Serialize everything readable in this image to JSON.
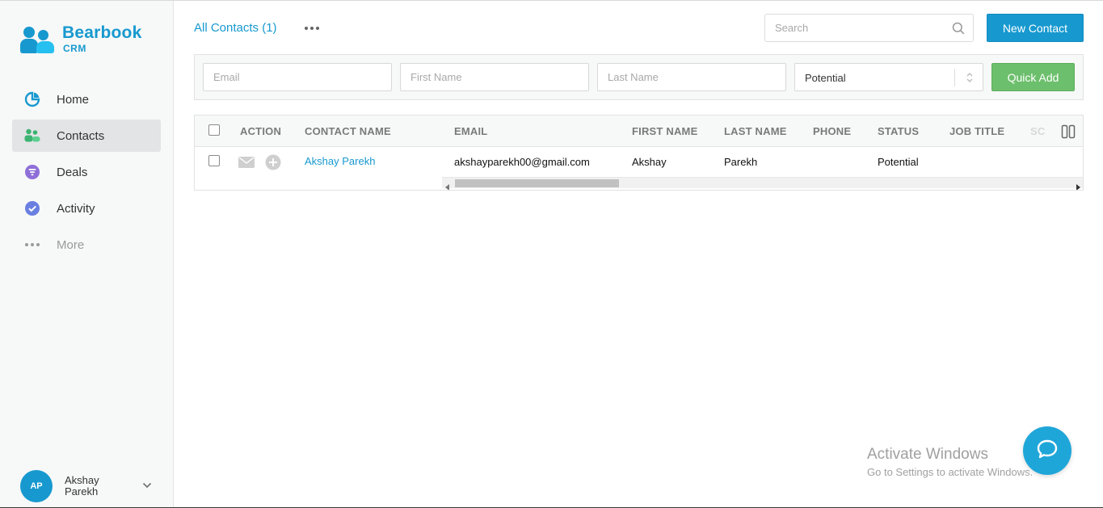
{
  "brand": {
    "name": "Bearbook",
    "sub": "CRM",
    "color": "#1799cf"
  },
  "sidebar": {
    "items": [
      {
        "label": "Home",
        "icon": "pie-chart-icon",
        "active": false
      },
      {
        "label": "Contacts",
        "icon": "people-icon",
        "active": true
      },
      {
        "label": "Deals",
        "icon": "filter-icon",
        "active": false
      },
      {
        "label": "Activity",
        "icon": "check-circle-icon",
        "active": false
      },
      {
        "label": "More",
        "icon": "more-dots-icon",
        "active": false
      }
    ]
  },
  "user": {
    "initials": "AP",
    "name": "Akshay Parekh"
  },
  "header": {
    "title": "All Contacts (1)",
    "search_placeholder": "Search",
    "new_button": "New Contact"
  },
  "quickadd": {
    "email_placeholder": "Email",
    "first_placeholder": "First Name",
    "last_placeholder": "Last Name",
    "status_value": "Potential",
    "button": "Quick Add"
  },
  "table": {
    "columns": [
      "ACTION",
      "CONTACT NAME",
      "EMAIL",
      "FIRST NAME",
      "LAST NAME",
      "PHONE",
      "STATUS",
      "JOB TITLE",
      "SC"
    ],
    "rows": [
      {
        "contact_name": "Akshay Parekh",
        "email": "akshayparekh00@gmail.com",
        "first_name": "Akshay",
        "last_name": "Parekh",
        "phone": "",
        "status": "Potential",
        "job_title": ""
      }
    ]
  },
  "watermark": {
    "title": "Activate Windows",
    "sub": "Go to Settings to activate Windows."
  },
  "colors": {
    "accent": "#1799cf",
    "green": "#6cbf6c",
    "chat": "#1fa6d9"
  }
}
